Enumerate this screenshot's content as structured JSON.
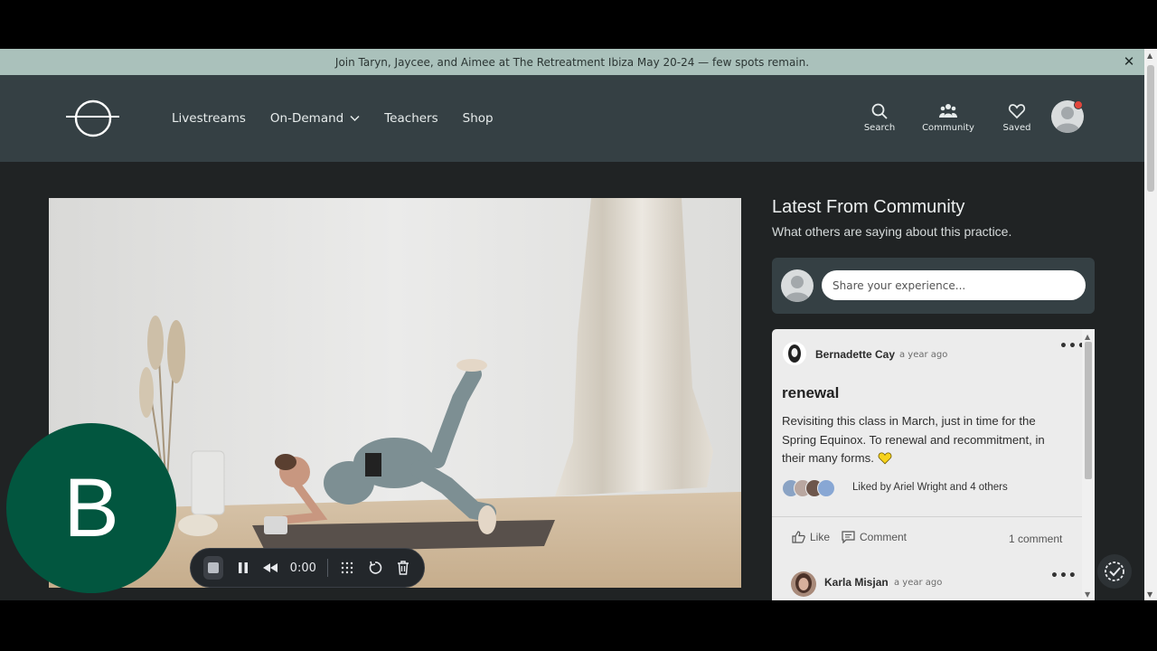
{
  "announcement": {
    "text": "Join Taryn, Jaycee, and Aimee at The Retreatment Ibiza May 20-24 — few spots remain.",
    "close_symbol": "✕"
  },
  "nav": {
    "livestreams": "Livestreams",
    "on_demand": "On-Demand",
    "teachers": "Teachers",
    "shop": "Shop"
  },
  "header_icons": {
    "search": "Search",
    "community": "Community",
    "saved": "Saved"
  },
  "recorder": {
    "time": "0:00"
  },
  "badge": {
    "letter": "B"
  },
  "community": {
    "title": "Latest From Community",
    "subtitle": "What others are saying about this practice.",
    "share_placeholder": "Share your experience..."
  },
  "post": {
    "author": "Bernadette Cay",
    "time": "a year ago",
    "title": "renewal",
    "body": "Revisiting this class in March, just in time for the Spring Equinox. To renewal and recommitment, in their many forms.",
    "liked_by": "Liked by Ariel Wright and 4 others",
    "like_label": "Like",
    "comment_label": "Comment",
    "comment_count": "1 comment"
  },
  "reply": {
    "author": "Karla Misjan",
    "time": "a year ago"
  },
  "colors": {
    "header_bg": "#354044",
    "announcement_bg": "#aac1bb",
    "badge_bg": "#02563f",
    "page_bg": "#202324",
    "notification": "#e2463c"
  }
}
